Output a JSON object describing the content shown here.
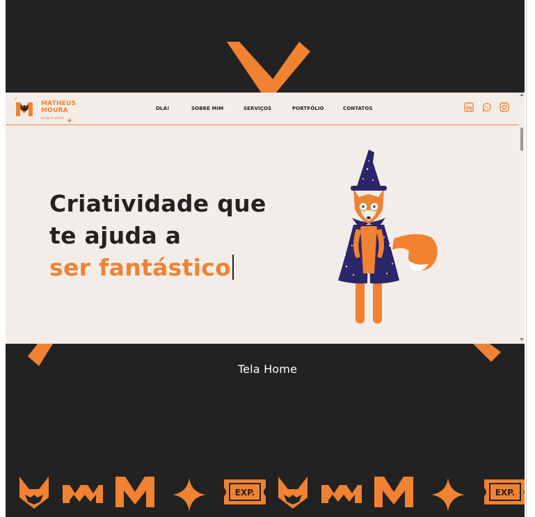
{
  "logo": {
    "line1": "MATHEUS",
    "line2": "MOURA",
    "tagline": "Designer gráfico",
    "icon": "fox-mm-monogram-icon"
  },
  "nav": {
    "items": [
      "OLÁ!",
      "SOBRE MIM",
      "SERVIÇOS",
      "PORTFÓLIO",
      "CONTATOS"
    ]
  },
  "social": {
    "icons": [
      "linkedin-icon",
      "whatsapp-icon",
      "instagram-icon"
    ]
  },
  "hero": {
    "line1": "Criatividade que",
    "line2": "te ajuda a",
    "line3": "ser fantástico"
  },
  "caption": "Tela Home",
  "footer": {
    "badge1": "EXP.",
    "badge2": "EXP.",
    "icons": [
      "fox-head-icon",
      "mm-monogram-icon",
      "m-letter-icon",
      "sparkle-star-icon",
      "ticket-badge-icon"
    ]
  },
  "colors": {
    "accent": "#f08232",
    "dark": "#232222",
    "cream": "#f2ede9",
    "wizard_navy": "#2b2569"
  }
}
